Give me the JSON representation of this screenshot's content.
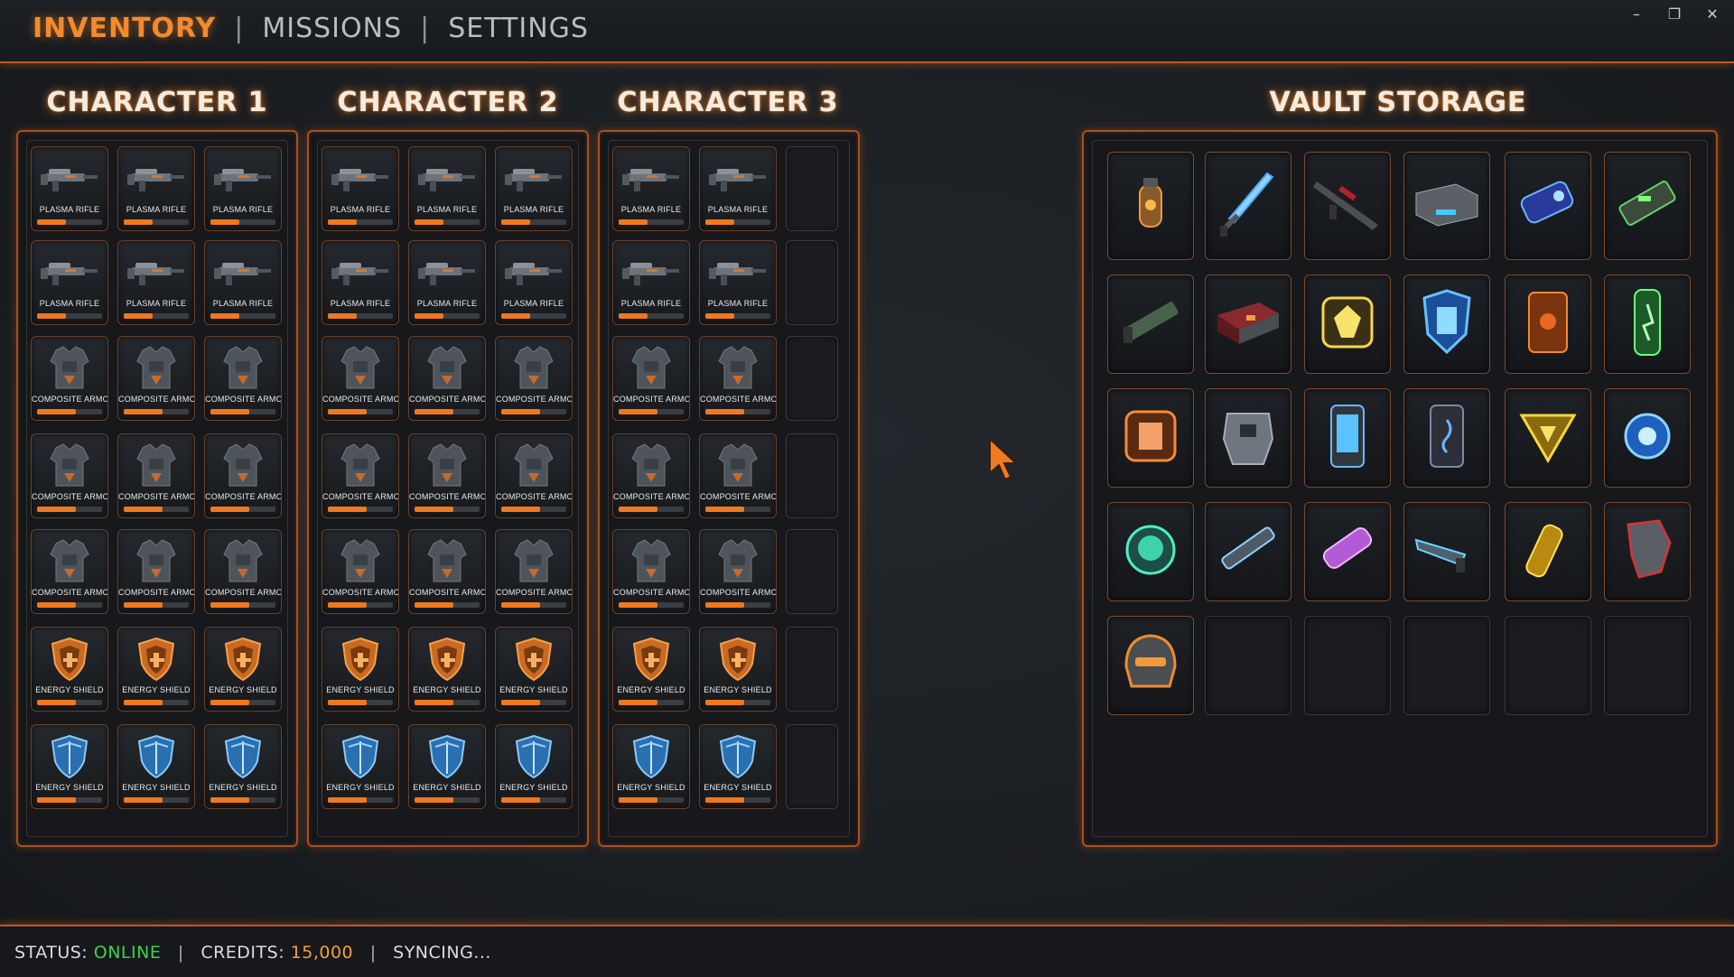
{
  "nav": {
    "tabs": [
      "INVENTORY",
      "MISSIONS",
      "SETTINGS"
    ],
    "active": 0
  },
  "window": {
    "minimize": "–",
    "restore": "❐",
    "close": "✕"
  },
  "characters": [
    {
      "title": "CHARACTER 1",
      "columns": 3
    },
    {
      "title": "CHARACTER 2",
      "columns": 3
    },
    {
      "title": "CHARACTER 3",
      "columns": 2
    }
  ],
  "item_rows": [
    {
      "label": "PLASMA RIFLE",
      "icon": "plasma-rifle-icon",
      "durability": 0.45
    },
    {
      "label": "PLASMA RIFLE",
      "icon": "plasma-rifle-icon",
      "durability": 0.45
    },
    {
      "label": "COMPOSITE ARMOR",
      "icon": "composite-armor-icon",
      "durability": 0.6
    },
    {
      "label": "COMPOSITE ARMOR",
      "icon": "composite-armor-icon",
      "durability": 0.6
    },
    {
      "label": "COMPOSITE ARMOR",
      "icon": "composite-armor-icon",
      "durability": 0.6
    },
    {
      "label": "ENERGY SHIELD",
      "icon": "energy-shield-orange-icon",
      "durability": 0.6
    },
    {
      "label": "ENERGY SHIELD",
      "icon": "energy-shield-blue-icon",
      "durability": 0.6
    }
  ],
  "vault": {
    "title": "VAULT STORAGE",
    "items": [
      "grenade-icon",
      "sword-icon",
      "sniper-rifle-icon",
      "ammo-crate-icon",
      "power-cell-icon",
      "heavy-cannon-icon",
      "shotgun-icon",
      "supply-case-icon",
      "gem-crystal-icon",
      "blue-shield-emblem-icon",
      "data-card-icon",
      "green-canister-icon",
      "orange-module-icon",
      "robot-torso-icon",
      "phone-device-icon",
      "hologram-device-icon",
      "yellow-triangle-badge-icon",
      "blue-orb-icon",
      "green-orb-icon",
      "blade-weapon-icon",
      "pink-crystal-icon",
      "blaster-pistol-icon",
      "yellow-vial-icon",
      "gauntlet-icon",
      "combat-helmet-icon",
      "",
      "",
      "",
      "",
      ""
    ]
  },
  "status": {
    "status_label": "STATUS:",
    "status_value": "ONLINE",
    "credits_label": "CREDITS:",
    "credits_value": "15,000",
    "sync": "SYNCING..."
  },
  "colors": {
    "accent": "#f28a2e",
    "online": "#3fd24a",
    "credits": "#f1a13a"
  }
}
